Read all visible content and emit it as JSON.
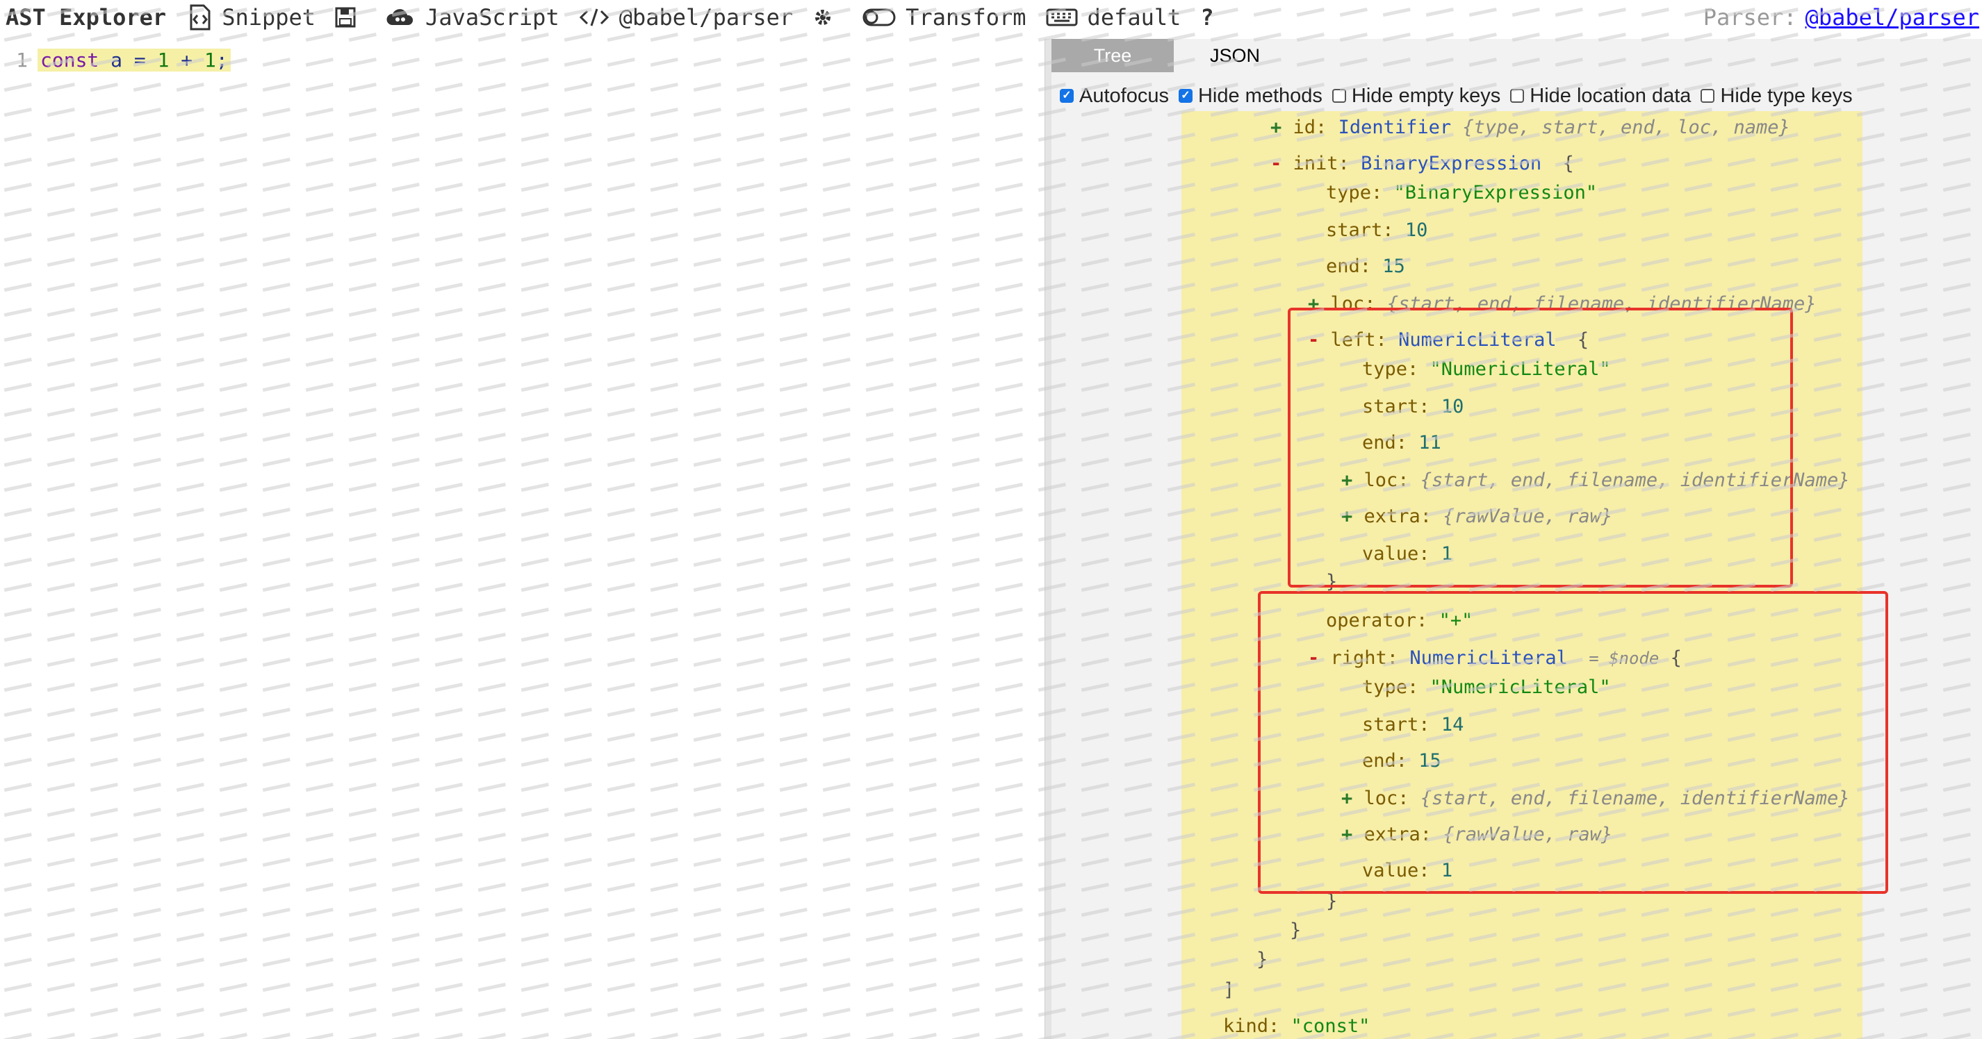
{
  "toolbar": {
    "title": "AST Explorer",
    "snippet": "Snippet",
    "language": "JavaScript",
    "parser": "@babel/parser",
    "transform": "Transform",
    "keymap": "default",
    "help": "?",
    "parser_label": "Parser:",
    "parser_link": "@babel/parser"
  },
  "editor": {
    "line_number": "1",
    "code": {
      "kw": "const",
      "name": " a = ",
      "n1": "1",
      "op": " + ",
      "n2": "1",
      "end": ";"
    }
  },
  "panel": {
    "tabs": [
      {
        "label": "Tree",
        "active": true
      },
      {
        "label": "JSON",
        "active": false
      }
    ],
    "options": [
      {
        "label": "Autofocus",
        "checked": true
      },
      {
        "label": "Hide methods",
        "checked": true
      },
      {
        "label": "Hide empty keys",
        "checked": false
      },
      {
        "label": "Hide location data",
        "checked": false
      },
      {
        "label": "Hide type keys",
        "checked": false
      }
    ]
  },
  "tree": {
    "id_line": {
      "sign": "+",
      "key": "id:",
      "type": "Identifier",
      "meta": "{type, start, end, loc, name}"
    },
    "init_line": {
      "sign": "-",
      "key": "init:",
      "type": "BinaryExpression",
      "brace": "{"
    },
    "init_type": {
      "key": "type:",
      "value": "\"BinaryExpression\""
    },
    "init_start": {
      "key": "start:",
      "value": "10"
    },
    "init_end": {
      "key": "end:",
      "value": "15"
    },
    "init_loc": {
      "sign": "+",
      "key": "loc:",
      "meta": "{start, end, filename, identifierName}"
    },
    "left_line": {
      "sign": "-",
      "key": "left:",
      "type": "NumericLiteral",
      "brace": "{"
    },
    "left_type": {
      "key": "type:",
      "value": "\"NumericLiteral\""
    },
    "left_start": {
      "key": "start:",
      "value": "10"
    },
    "left_end": {
      "key": "end:",
      "value": "11"
    },
    "left_loc": {
      "sign": "+",
      "key": "loc:",
      "meta": "{start, end, filename, identifierName}"
    },
    "left_extra": {
      "sign": "+",
      "key": "extra:",
      "meta": "{rawValue, raw}"
    },
    "left_value": {
      "key": "value:",
      "value": "1"
    },
    "left_close": "}",
    "operator": {
      "key": "operator:",
      "value": "\"+\""
    },
    "right_line": {
      "sign": "-",
      "key": "right:",
      "type": "NumericLiteral",
      "node": "= $node",
      "brace": "{"
    },
    "right_type": {
      "key": "type:",
      "value": "\"NumericLiteral\""
    },
    "right_start": {
      "key": "start:",
      "value": "14"
    },
    "right_end": {
      "key": "end:",
      "value": "15"
    },
    "right_loc": {
      "sign": "+",
      "key": "loc:",
      "meta": "{start, end, filename, identifierName}"
    },
    "right_extra": {
      "sign": "+",
      "key": "extra:",
      "meta": "{rawValue, raw}"
    },
    "right_value": {
      "key": "value:",
      "value": "1"
    },
    "right_close": "}",
    "init_close": "}",
    "decl_close": "}",
    "decls_close": "]",
    "kind": {
      "key": "kind:",
      "value": "\"const\""
    }
  },
  "colors": {
    "highlight": "#f7eea8",
    "annotation": "#e8332a",
    "link": "#1a0dff"
  }
}
